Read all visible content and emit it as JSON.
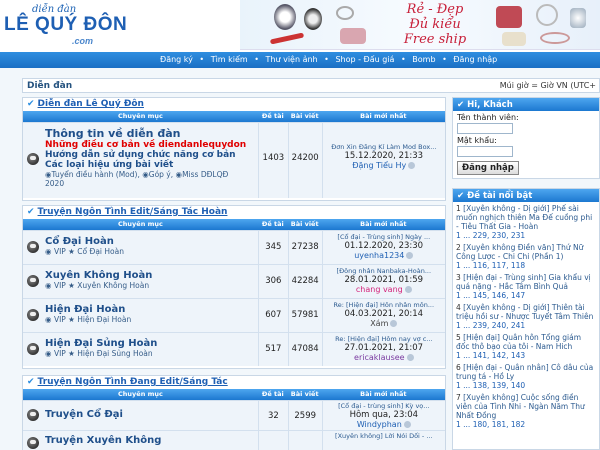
{
  "header": {
    "logo_top": "diễn đàn",
    "logo_main": "LÊ QUÝ ĐÔN",
    "logo_sub": ".com",
    "banner_slogan_1": "Rẻ - Đẹp",
    "banner_slogan_2": "Đủ kiểu",
    "banner_slogan_3": "Free ship"
  },
  "nav": {
    "items": [
      "Đăng ký",
      "Tìm kiếm",
      "Thư viện ảnh",
      "Shop - Đấu giá",
      "Bomb",
      "Đăng nhập"
    ],
    "separator": "•"
  },
  "breadcrumb": {
    "label": "Diễn đàn",
    "timezone": "Múi giờ = Giờ VN (UTC+"
  },
  "categories": [
    {
      "title": "Diễn đàn Lê Quý Đôn",
      "headers": {
        "name": "Chuyên mục",
        "topics": "Đề tài",
        "posts": "Bài viết",
        "last": "Bài mới nhất"
      },
      "forums": [
        {
          "name": "Thông tin về diễn đàn",
          "line_red": "Những điều cơ bản về diendanlequydon",
          "line_blue1": "Hướng dẫn sử dụng chức năng cơ bản",
          "line_blue2": "Các loại hiệu ứng bài viết",
          "subforums_1": "Tuyển điều hành (Mod), ",
          "subforums_2": "Góp ý, ",
          "subforums_3": "Miss DĐLQĐ",
          "subforums_4": "2020",
          "topics": "1403",
          "posts": "24200",
          "last_title": "Đơn Xin Đăng Kí Làm Mod Box...",
          "last_time": "15.12.2020, 21:33",
          "last_user": "Đặng Tiểu Hy"
        }
      ]
    },
    {
      "title": "Truyện Ngôn Tình Edit/Sáng Tác Hoàn",
      "headers": {
        "name": "Chuyên mục",
        "topics": "Đề tài",
        "posts": "Bài viết",
        "last": "Bài mới nhất"
      },
      "forums": [
        {
          "name": "Cổ Đại Hoàn",
          "sub": "VIP  ★ Cổ Đại Hoàn",
          "topics": "345",
          "posts": "27238",
          "last_title": "[Cổ đại - Trùng sinh] Ngày ...",
          "last_time": "01.12.2020, 23:30",
          "last_user": "uyenha1234"
        },
        {
          "name": "Xuyên Không Hoàn",
          "sub": "VIP  ★ Xuyên Không Hoàn",
          "topics": "306",
          "posts": "42284",
          "last_title": "[Đông nhân Nanbaka-Hoàn...",
          "last_time": "28.01.2021, 01:59",
          "last_user": "chang vang"
        },
        {
          "name": "Hiện Đại Hoàn",
          "sub": "VIP  ★ Hiện Đại Hoàn",
          "topics": "607",
          "posts": "57981",
          "last_title": "Re: [Hiện đại] Hôn nhân môn...",
          "last_time": "04.03.2021, 20:14",
          "last_user": "Xám"
        },
        {
          "name": "Hiện Đại Sủng Hoàn",
          "sub": "VIP  ★ Hiện Đại Sủng Hoàn",
          "topics": "517",
          "posts": "47084",
          "last_title": "Re: [Hiện đại] Hôm nay vợ c...",
          "last_time": "27.01.2021, 21:07",
          "last_user": "ericaklausee"
        }
      ]
    },
    {
      "title": "Truyện Ngôn Tình Đang Edit/Sáng Tác",
      "headers": {
        "name": "Chuyên mục",
        "topics": "Đề tài",
        "posts": "Bài viết",
        "last": "Bài mới nhất"
      },
      "forums": [
        {
          "name": "Truyện Cổ Đại",
          "topics": "32",
          "posts": "2599",
          "last_title": "[Cổ đại - trùng sinh] Kỳ vọ...",
          "last_time": "Hôm qua, 23:04",
          "last_user": "Windyphan"
        },
        {
          "name": "Truyện Xuyên Không",
          "topics": "",
          "posts": "",
          "last_title": "[Xuyên không] Lời Nói Dối - ...",
          "last_time": "",
          "last_user": ""
        }
      ]
    }
  ],
  "login": {
    "title": "Hi, Khách",
    "username_label": "Tên thành viên:",
    "password_label": "Mật khẩu:",
    "button": "Đăng nhập"
  },
  "hot_topics": {
    "title": "Đề tài nổi bật",
    "items": [
      {
        "n": "1",
        "text": "[Xuyên không - Dị giới] Phế sài muốn nghịch thiên Ma Đế cuồng phi - Tiêu Thất Gia - Hoàn",
        "pages": "1 ... 229, 230, 231"
      },
      {
        "n": "2",
        "text": "[Xuyên không Điền văn] Thứ Nữ Công Lược - Chi Chi (Phần 1)",
        "pages": "1 ... 116, 117, 118"
      },
      {
        "n": "3",
        "text": "[Hiện đại - Trùng sinh] Gia khẩu vị quá nặng - Hắc Tâm Bình Quả",
        "pages": "1 ... 145, 146, 147"
      },
      {
        "n": "4",
        "text": "[Xuyên không - Dị giới] Thiên tài triệu hồi sư - Nhược Tuyết Tâm Thiên",
        "pages": "1 ... 239, 240, 241"
      },
      {
        "n": "5",
        "text": "[Hiện đại] Quân hôn Tổng giám đốc thô bạo của tôi - Nam Hich",
        "pages": "1 ... 141, 142, 143"
      },
      {
        "n": "6",
        "text": "[Hiện đại - Quân nhân] Cô dâu của trung tá - Hồ Ly",
        "pages": "1 ... 138, 139, 140"
      },
      {
        "n": "7",
        "text": "[Xuyên không] Cuộc sống điền viên của Tình Nhi - Ngàn Năm Thư Nhất Đồng",
        "pages": "1 ... 180, 181, 182"
      }
    ]
  },
  "colors": {
    "nav": "#1b6fc4",
    "accent": "#1e5fb3",
    "red": "#e00000"
  }
}
